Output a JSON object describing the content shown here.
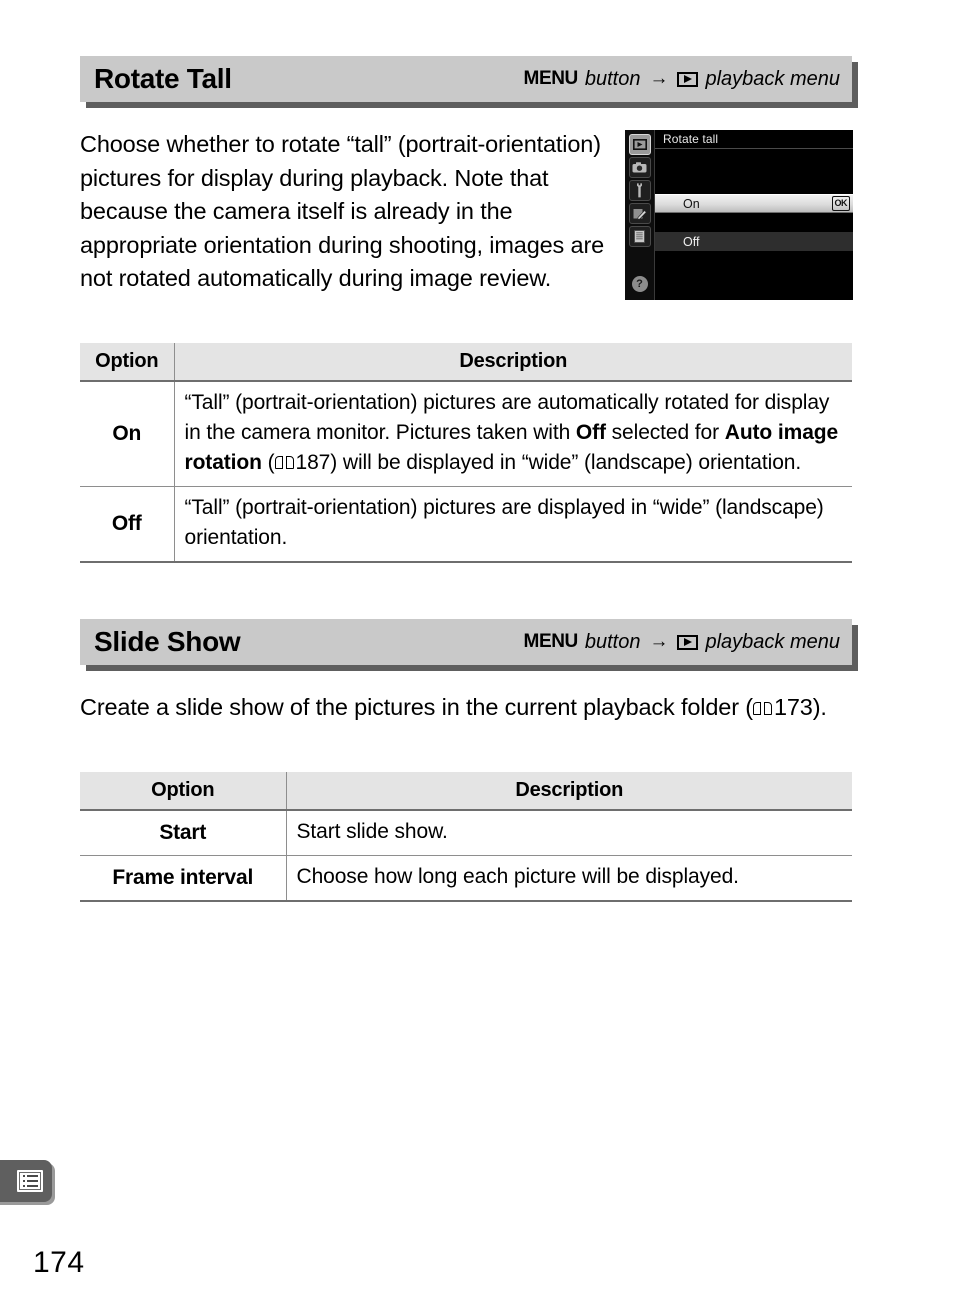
{
  "page": {
    "number": "174",
    "footer_tab_icon": "menu-list-icon"
  },
  "sections": [
    {
      "id": "rotate-tall",
      "title": "Rotate Tall",
      "path": {
        "menu_word": "MENU",
        "button_word": "button",
        "arrow": "→",
        "playback_icon": "playback-icon",
        "menu_name": "playback menu"
      },
      "body": "Choose whether to rotate “tall” (portrait-orientation) pictures for display during playback.  Note that because the camera itself is already in the appropriate orientation during shooting, images are not rotated automatically during image review.",
      "table": {
        "headers": [
          "Option",
          "Description"
        ],
        "rows": [
          {
            "option": "On",
            "desc_part_1": "“Tall” (portrait-orientation) pictures are automatically rotated for display in the camera monitor.  Pictures taken with ",
            "desc_bold_1": "Off",
            "desc_part_2": " selected for ",
            "desc_bold_2": "Auto image rotation",
            "desc_part_3": " (",
            "desc_ref": "187",
            "desc_part_4": ") will be displayed in “wide” (landscape) orientation."
          },
          {
            "option": "Off",
            "desc_plain": "“Tall” (portrait-orientation) pictures are displayed in “wide” (landscape) orientation."
          }
        ]
      }
    },
    {
      "id": "slide-show",
      "title": "Slide Show",
      "path": {
        "menu_word": "MENU",
        "button_word": "button",
        "arrow": "→",
        "playback_icon": "playback-icon",
        "menu_name": "playback menu"
      },
      "body_lead": "Create a slide show of the pictures in the current playback folder (",
      "body_ref": "173",
      "body_tail": ").",
      "table": {
        "headers": [
          "Option",
          "Description"
        ],
        "rows": [
          {
            "option": "Start",
            "desc": "Start slide show."
          },
          {
            "option": "Frame interval",
            "desc": "Choose how long each picture will be displayed."
          }
        ]
      }
    }
  ],
  "camera_screenshot": {
    "title": "Rotate tall",
    "sidebar_icons": [
      "playback-menu-icon",
      "shooting-menu-icon",
      "setup-menu-icon",
      "retouch-menu-icon",
      "recent-settings-icon"
    ],
    "help_label": "?",
    "options": [
      {
        "label": "On",
        "selected": true,
        "badge": "OK"
      },
      {
        "label": "Off",
        "selected": false,
        "badge": ""
      }
    ]
  },
  "colors": {
    "header_bar": "#c9c9c9",
    "header_shadow": "#5e5e5e",
    "table_header": "#e4e4e4",
    "rule": "#6e6e6e",
    "footer_tab": "#5f5f5f"
  }
}
